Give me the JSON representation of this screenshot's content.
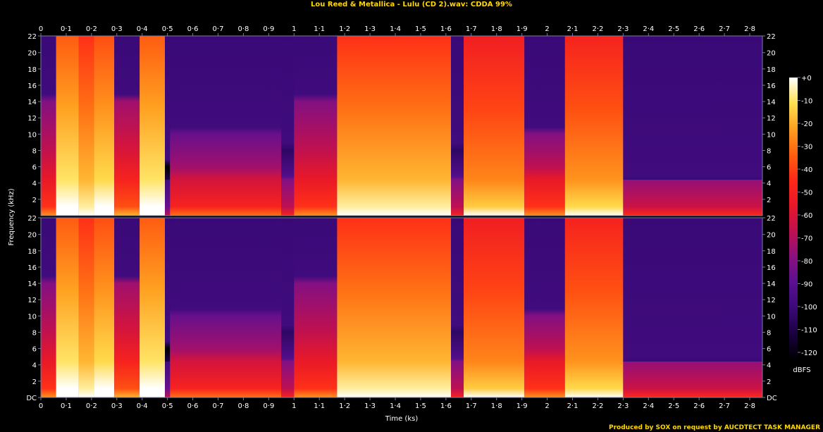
{
  "title": "Lou Reed & Metallica - Lulu (CD 2).wav: CDDA 99%",
  "footer": "Produced by SOX on request by AUCDTECT TASK MANAGER",
  "colors": {
    "background": "#000000",
    "title": "#ffd800",
    "axis": "#7a7aa0",
    "palette": [
      "#000000",
      "#1a0040",
      "#3a0a78",
      "#5a1090",
      "#8a1080",
      "#c01050",
      "#e81828",
      "#ff2818",
      "#ff6010",
      "#ffa020",
      "#ffe050",
      "#ffffff"
    ]
  },
  "chart_data": {
    "type": "heatmap",
    "subtype": "spectrogram",
    "channels": 2,
    "xlabel": "Time (ks)",
    "ylabel": "Frequency (kHz)",
    "colorbar_label": "dBFS",
    "xlim": [
      0,
      2.85
    ],
    "ylim": [
      0,
      22.05
    ],
    "x_ticks": [
      "0",
      "0·1",
      "0·2",
      "0·3",
      "0·4",
      "0·5",
      "0·6",
      "0·7",
      "0·8",
      "0·9",
      "1",
      "1·1",
      "1·2",
      "1·3",
      "1·4",
      "1·5",
      "1·6",
      "1·7",
      "1·8",
      "1·9",
      "2",
      "2·1",
      "2·2",
      "2·3",
      "2·4",
      "2·5",
      "2·6",
      "2·7",
      "2·8"
    ],
    "y_ticks_upper": [
      "22",
      "20",
      "18",
      "16",
      "14",
      "12",
      "10",
      "8",
      "6",
      "4",
      "2"
    ],
    "y_ticks_lower": [
      "22",
      "20",
      "18",
      "16",
      "14",
      "12",
      "10",
      "8",
      "6",
      "4",
      "2",
      "DC"
    ],
    "colorbar_ticks": [
      "+0",
      "-10",
      "-20",
      "-30",
      "-40",
      "-50",
      "-60",
      "-70",
      "-80",
      "-90",
      "-100",
      "-110",
      "-120"
    ],
    "segments": [
      {
        "start": 0.0,
        "end": 0.06,
        "level": 0.55,
        "cutoff": 14
      },
      {
        "start": 0.06,
        "end": 0.15,
        "level": 0.92,
        "cutoff": 22
      },
      {
        "start": 0.15,
        "end": 0.21,
        "level": 0.85,
        "cutoff": 22
      },
      {
        "start": 0.21,
        "end": 0.29,
        "level": 0.9,
        "cutoff": 22
      },
      {
        "start": 0.29,
        "end": 0.39,
        "level": 0.6,
        "cutoff": 14
      },
      {
        "start": 0.39,
        "end": 0.49,
        "level": 0.92,
        "cutoff": 22
      },
      {
        "start": 0.49,
        "end": 0.51,
        "level": 0.2,
        "cutoff": 6
      },
      {
        "start": 0.51,
        "end": 0.95,
        "level": 0.5,
        "cutoff": 10
      },
      {
        "start": 0.95,
        "end": 1.0,
        "level": 0.35,
        "cutoff": 8
      },
      {
        "start": 1.0,
        "end": 1.17,
        "level": 0.55,
        "cutoff": 14
      },
      {
        "start": 1.17,
        "end": 1.62,
        "level": 0.85,
        "cutoff": 22
      },
      {
        "start": 1.62,
        "end": 1.67,
        "level": 0.35,
        "cutoff": 8
      },
      {
        "start": 1.67,
        "end": 1.91,
        "level": 0.78,
        "cutoff": 22
      },
      {
        "start": 1.91,
        "end": 2.07,
        "level": 0.55,
        "cutoff": 10
      },
      {
        "start": 2.07,
        "end": 2.3,
        "level": 0.8,
        "cutoff": 22
      },
      {
        "start": 2.3,
        "end": 2.85,
        "level": 0.38,
        "cutoff": 4
      }
    ]
  }
}
